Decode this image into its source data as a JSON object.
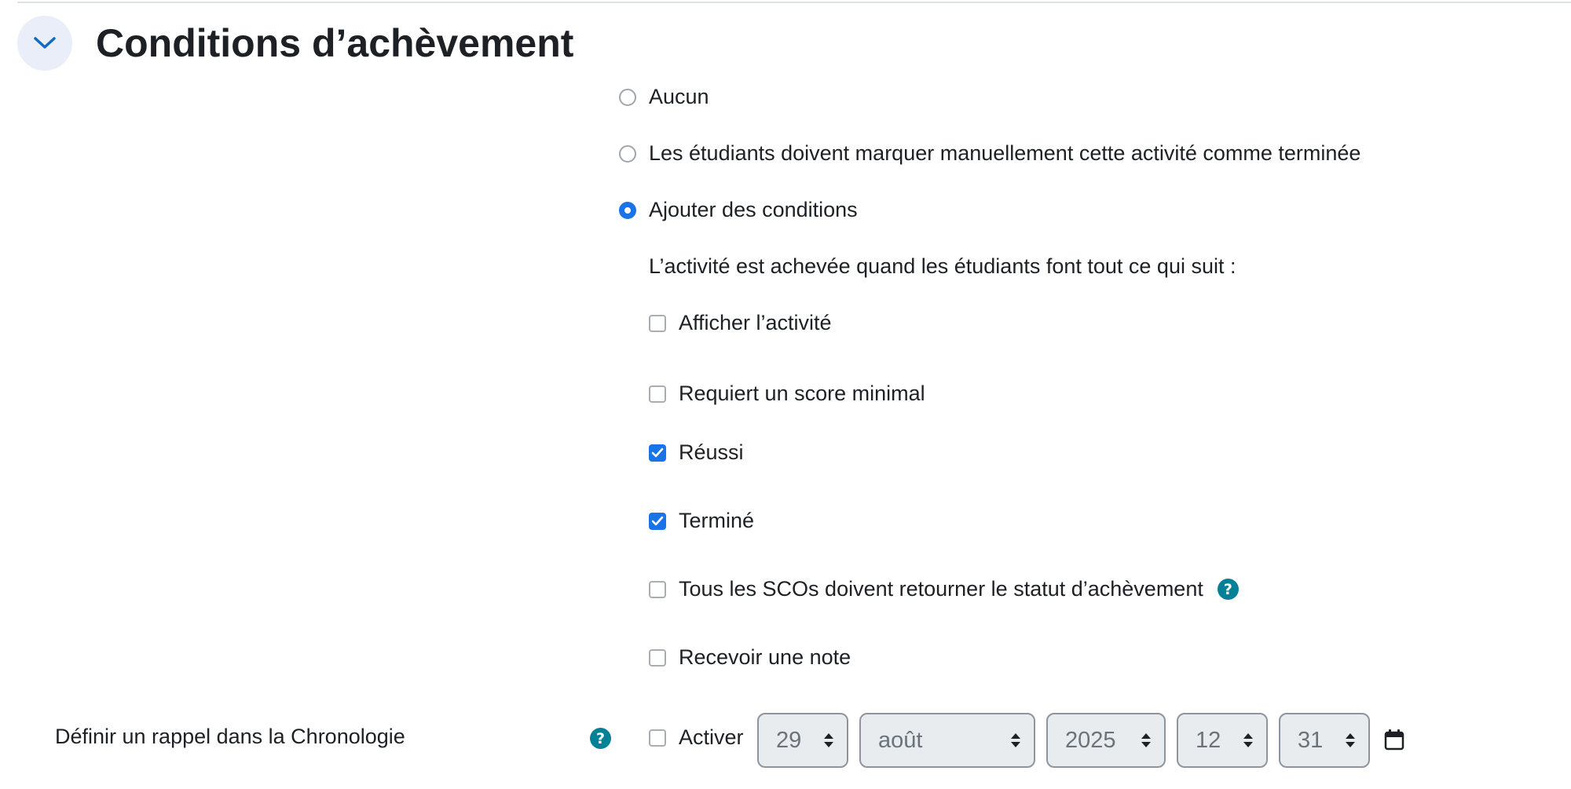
{
  "section": {
    "title": "Conditions d’achèvement",
    "collapse_icon": "chevron-down-icon"
  },
  "completion": {
    "options": [
      {
        "label": "Aucun",
        "checked": false
      },
      {
        "label": "Les étudiants doivent marquer manuellement cette activité comme terminée",
        "checked": false
      },
      {
        "label": "Ajouter des conditions",
        "checked": true
      }
    ],
    "conditions_intro": "L’activité est achevée quand les étudiants font tout ce qui suit :",
    "conditions": [
      {
        "label": "Afficher l’activité",
        "checked": false
      },
      {
        "label": "Requiert un score minimal",
        "checked": false
      },
      {
        "label": "Réussi",
        "checked": true
      },
      {
        "label": "Terminé",
        "checked": true
      },
      {
        "label": "Tous les SCOs doivent retourner le statut d’achèvement",
        "checked": false,
        "help": true
      },
      {
        "label": "Recevoir une note",
        "checked": false
      }
    ]
  },
  "reminder": {
    "label": "Définir un rappel dans la Chronologie",
    "enable_label": "Activer",
    "enabled": false,
    "day": "29",
    "month": "août",
    "year": "2025",
    "hour": "12",
    "minute": "31",
    "calendar_icon": "calendar-icon"
  },
  "colors": {
    "accent": "#1a73e8",
    "help": "#008196",
    "collapse_bg": "#e9eef8"
  }
}
